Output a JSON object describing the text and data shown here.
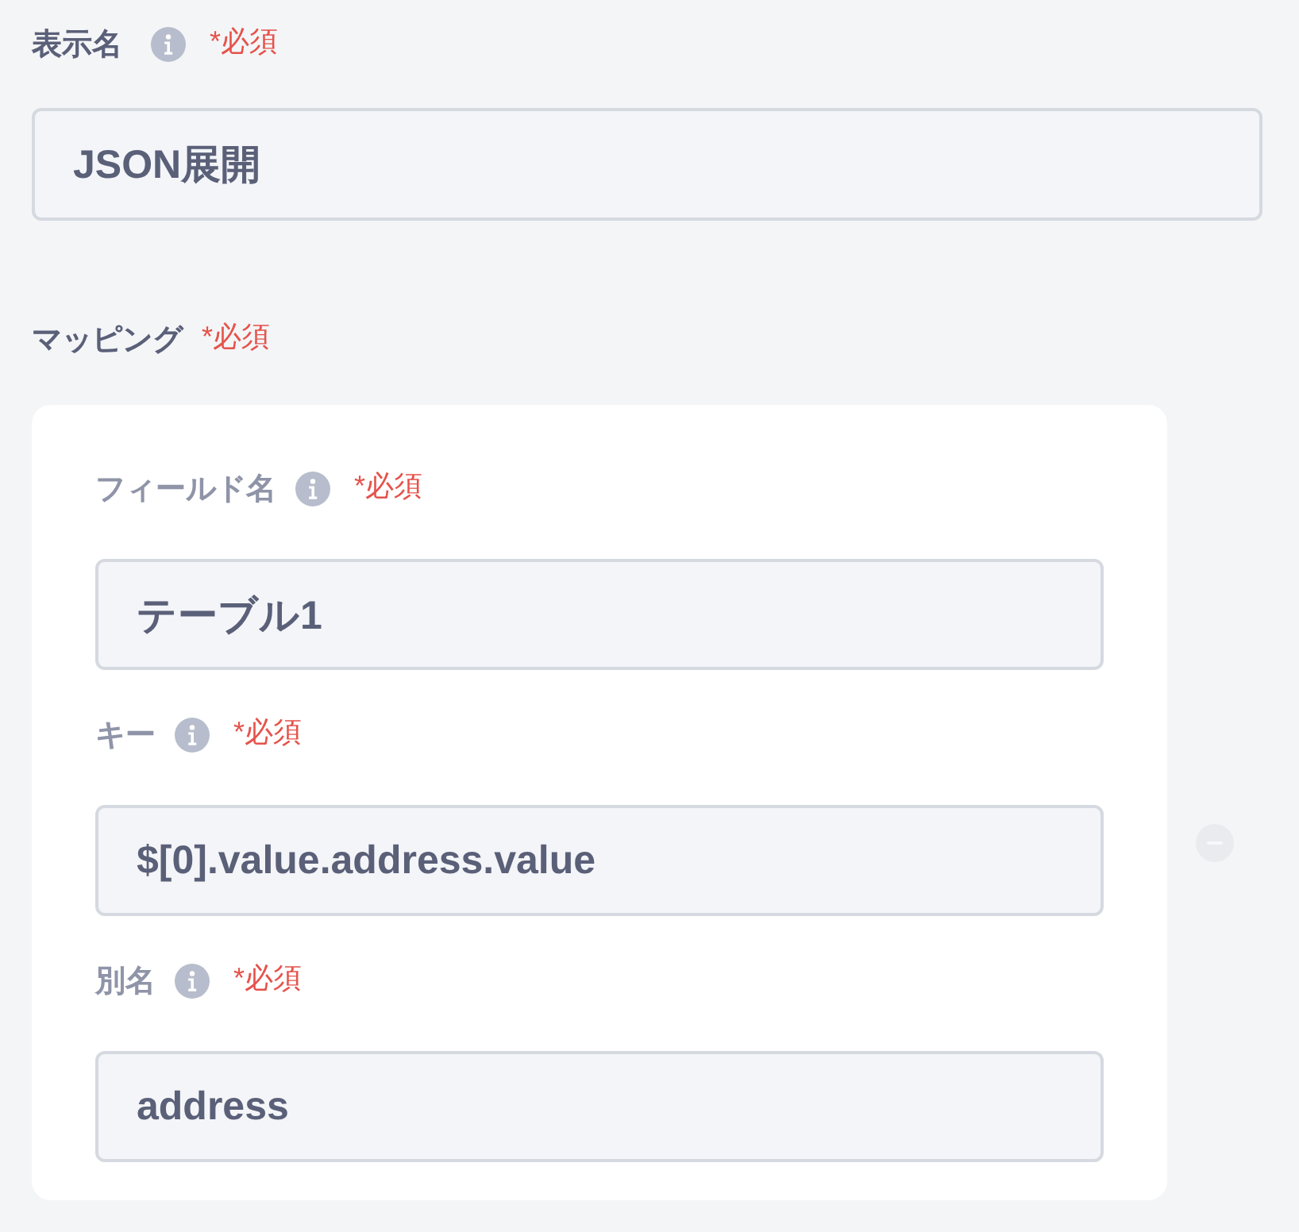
{
  "display_name": {
    "label": "表示名",
    "info": true,
    "required": "*必須",
    "value": "JSON展開"
  },
  "mapping": {
    "label": "マッピング",
    "info": false,
    "required": "*必須",
    "items": [
      {
        "fields": [
          {
            "label": "フィールド名",
            "info": true,
            "required": "*必須",
            "value": "テーブル1"
          },
          {
            "label": "キー",
            "info": true,
            "required": "*必須",
            "value": "$[0].value.address.value"
          },
          {
            "label": "別名",
            "info": true,
            "required": "*必須",
            "value": "address"
          }
        ],
        "remove_disabled": true
      }
    ]
  }
}
